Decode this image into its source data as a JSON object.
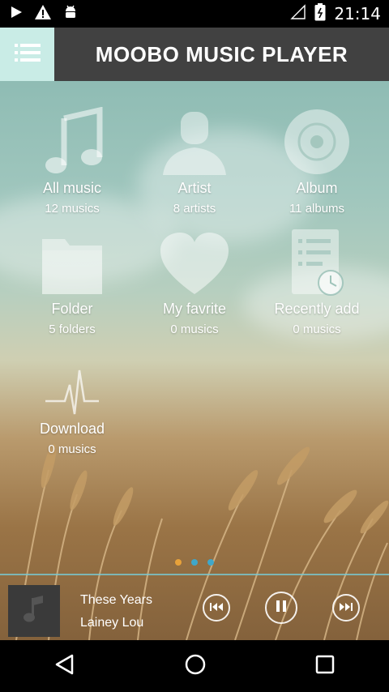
{
  "status_bar": {
    "time": "21:14",
    "left_icons": [
      "play-icon",
      "warning-icon",
      "android-icon"
    ],
    "right_icons": [
      "signal-icon",
      "battery-icon"
    ]
  },
  "header": {
    "title": "MOOBO MUSIC PLAYER",
    "menu_icon": "list-menu-icon",
    "accent": "#c9ece6"
  },
  "categories": [
    {
      "id": "all-music",
      "label": "All music",
      "count": "12 musics",
      "icon": "music-note-icon"
    },
    {
      "id": "artist",
      "label": "Artist",
      "count": "8 artists",
      "icon": "person-icon"
    },
    {
      "id": "album",
      "label": "Album",
      "count": "11 albums",
      "icon": "disc-icon"
    },
    {
      "id": "folder",
      "label": "Folder",
      "count": "5 folders",
      "icon": "folder-icon"
    },
    {
      "id": "favorite",
      "label": "My favrite",
      "count": "0 musics",
      "icon": "heart-icon"
    },
    {
      "id": "recently-add",
      "label": "Recently add",
      "count": "0 musics",
      "icon": "recent-list-icon"
    },
    {
      "id": "download",
      "label": "Download",
      "count": "0 musics",
      "icon": "pulse-icon"
    }
  ],
  "page_dots": {
    "count": 3,
    "active_index": 0,
    "colors": [
      "#e8a23a",
      "#3fa7c9",
      "#3fa7c9"
    ]
  },
  "now_playing": {
    "title": "These Years",
    "artist": "Lainey Lou",
    "controls": [
      "previous-icon",
      "pause-icon",
      "next-icon"
    ]
  },
  "nav_bar": [
    "back-icon",
    "home-icon",
    "recents-icon"
  ]
}
